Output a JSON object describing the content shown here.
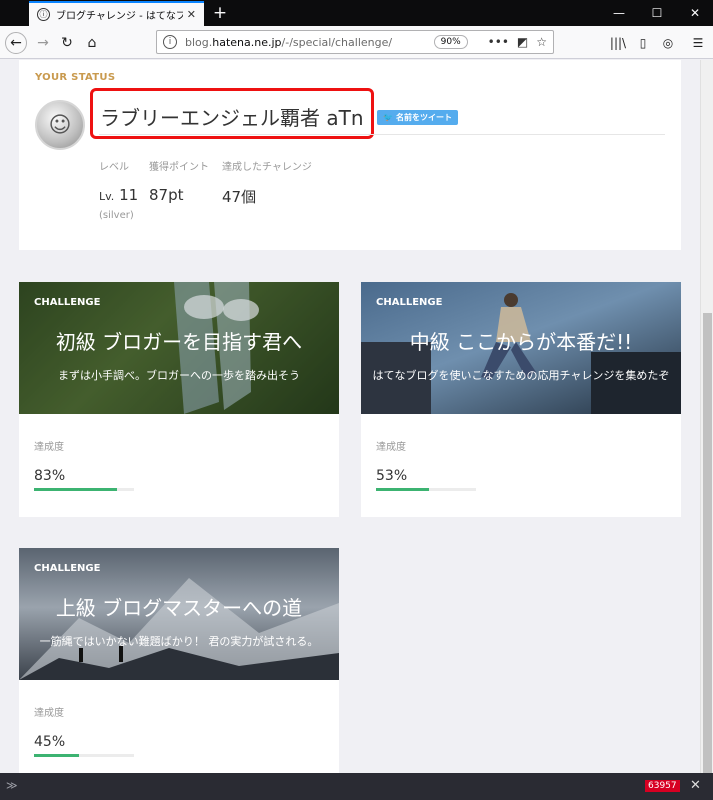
{
  "browser": {
    "tab_title": "ブログチャレンジ - はてなブログ",
    "url_prefix": "blog.",
    "url_domain": "hatena.ne.jp",
    "url_path": "/-/special/challenge/",
    "zoom": "90%",
    "more_icon": "•••",
    "new_tab_icon": "+"
  },
  "status": {
    "label": "YOUR STATUS",
    "name": "ラブリーエンジェル覇者 aTn",
    "tweet_label": "名前をツイート",
    "stats": {
      "level_head": "レベル",
      "level_prefix": "Lv.",
      "level_value": "11",
      "level_rank": "(silver)",
      "points_head": "獲得ポイント",
      "points_value": "87pt",
      "achieved_head": "達成したチャレンジ",
      "achieved_value": "47個"
    }
  },
  "challenges": [
    {
      "tag": "CHALLENGE",
      "title": "初級 ブロガーを目指す君へ",
      "subtitle": "まずは小手調べ。ブロガーへの一歩を踏み出そう",
      "progress_label": "達成度",
      "progress_text": "83%",
      "progress": 0.83
    },
    {
      "tag": "CHALLENGE",
      "title": "中級 ここからが本番だ!!",
      "subtitle": "はてなブログを使いこなすための応用チャレンジを集めたぞ",
      "progress_label": "達成度",
      "progress_text": "53%",
      "progress": 0.53
    },
    {
      "tag": "CHALLENGE",
      "title": "上級 ブログマスターへの道",
      "subtitle": "一筋縄ではいかない難題ばかり！ 君の実力が試される。",
      "progress_label": "達成度",
      "progress_text": "45%",
      "progress": 0.45
    }
  ],
  "devbar": {
    "badge": "63957"
  },
  "colors": {
    "accent": "#c99a4e",
    "progress": "#3cb371",
    "highlight": "#ee1111",
    "twitter": "#55acee"
  }
}
